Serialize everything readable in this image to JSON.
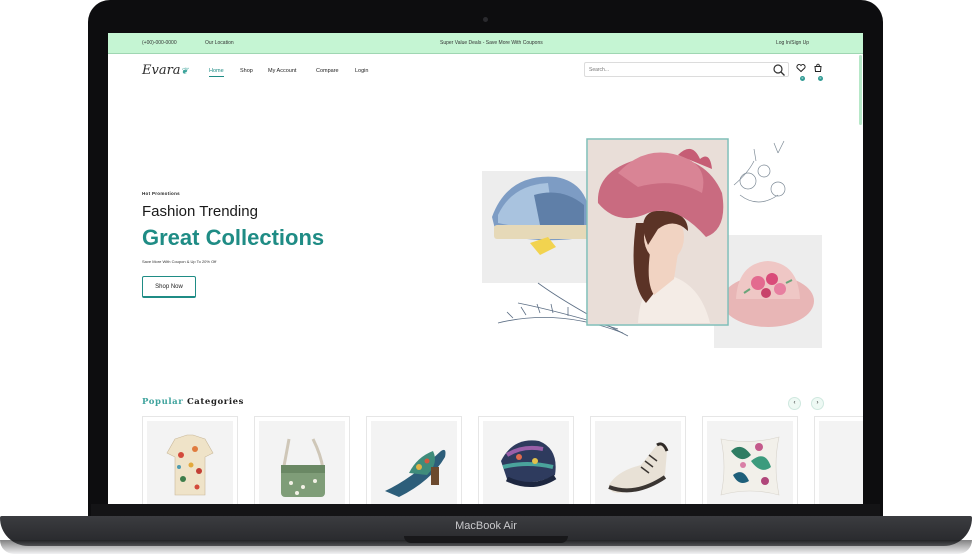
{
  "device": {
    "model_label": "MacBook Air"
  },
  "topbar": {
    "phone": "(+00)-000-0000",
    "location": "Our Location",
    "promo": "Super Value Deals - Save More With Coupons",
    "login": "Log In/Sign Up"
  },
  "header": {
    "logo": "Evara",
    "nav": [
      "Home",
      "Shop",
      "My Account",
      "Compare",
      "Login"
    ],
    "search_placeholder": "Search...",
    "wishlist_count": "0",
    "cart_count": "0"
  },
  "hero": {
    "eyebrow": "Hot Promotions",
    "title": "Fashion Trending",
    "subtitle": "Great Collections",
    "description": "Save More With Coupon & Up To 20% Off",
    "button": "Shop Now"
  },
  "categories": {
    "title_highlight": "Popular",
    "title_rest": "Categories",
    "prev_icon": "arrow-left-icon",
    "next_icon": "arrow-right-icon",
    "items": [
      {
        "icon": "shirt"
      },
      {
        "icon": "bag"
      },
      {
        "icon": "sandal"
      },
      {
        "icon": "beanie"
      },
      {
        "icon": "sneaker"
      },
      {
        "icon": "pillow"
      }
    ]
  },
  "colors": {
    "accent": "#1f8c85",
    "topbar": "#c5f5d3"
  }
}
